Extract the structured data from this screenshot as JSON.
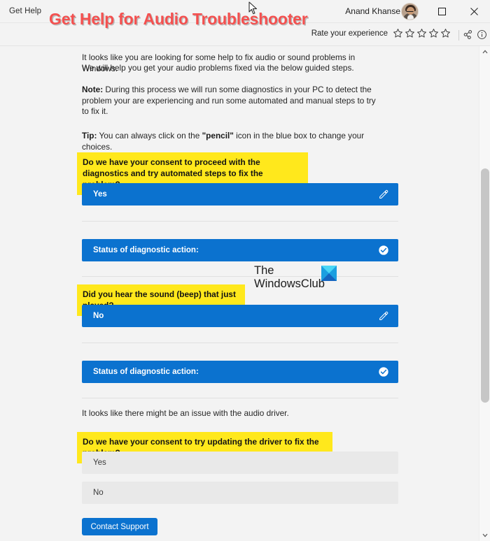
{
  "window": {
    "app_name": "Get Help",
    "account_name": "Anand Khanse",
    "minimize_label": "Minimize",
    "maximize_label": "Maximize",
    "close_label": "Close"
  },
  "subheader": {
    "rate_label": "Rate your experience",
    "star_count": 5,
    "share_icon": "share-icon",
    "info_icon": "info-icon"
  },
  "content": {
    "intro_line1": "It looks like you are looking for some help to fix audio or sound problems in Windows.",
    "intro_line2": "We will help you get your audio problems fixed via the below guided steps.",
    "note_label": "Note:",
    "note_text": " During this process we will run some diagnostics in your PC to detect the problem your are experiencing and run some automated  and manual steps to try to fix it.",
    "tip_label": "Tip:",
    "tip_text_before": " You can always click on the ",
    "tip_bold": "\"pencil\"",
    "tip_text_after": " icon in the blue box to change your choices.",
    "question1": "Do we have your consent to proceed with the diagnostics and try automated steps to fix the problem?",
    "answer1": "Yes",
    "status1": "Status of diagnostic action:",
    "question2": "Did you hear the sound (beep) that just played?",
    "answer2": "No",
    "status2": "Status of diagnostic action:",
    "driver_text": "It looks like there might be an issue with the audio driver.",
    "question3": "Do we have your consent to try updating the driver to fix the problem?",
    "option_yes": "Yes",
    "option_no": "No",
    "contact_support": "Contact Support",
    "edit_icon": "pencil-icon",
    "status_icon": "check-circle-icon"
  },
  "watermark": {
    "title": "Get Help for Audio Troubleshooter",
    "brand_line1": "The",
    "brand_line2": "WindowsClub"
  },
  "colors": {
    "accent_blue": "#0b72cf",
    "highlight_yellow": "#ffe81c",
    "watermark_red": "#f4504f",
    "option_grey": "#e9e9e9",
    "page_background": "#f3f3f3"
  }
}
